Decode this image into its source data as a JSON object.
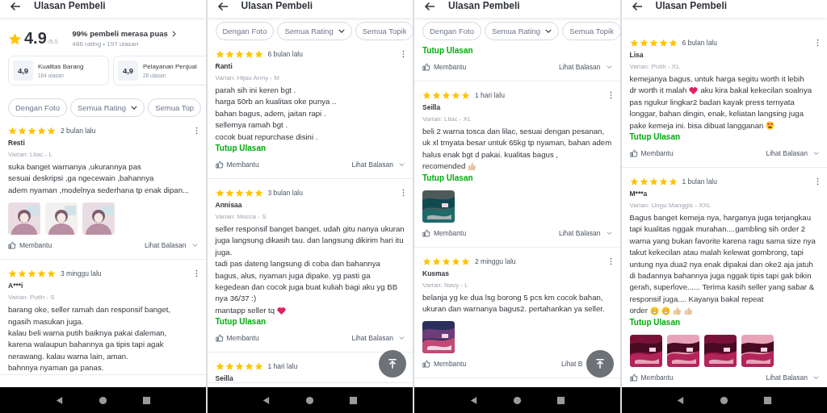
{
  "screens": [
    {
      "header": {
        "title": "Ulasan Pembeli"
      },
      "summary": {
        "score": "4.9",
        "scale": "/5.0",
        "headline": "99% pembeli merasa puas",
        "counts": "486 rating • 197 ulasan",
        "aspects": [
          {
            "score": "4,9",
            "label": "Kualitas Barang",
            "count": "164 ulasan"
          },
          {
            "score": "4,9",
            "label": "Pelayanan Penjual",
            "count": "28 ulasan"
          }
        ]
      },
      "filters": [
        {
          "label": "Dengan Foto",
          "dropdown": false
        },
        {
          "label": "Semua Rating",
          "dropdown": true
        },
        {
          "label": "Semua Top",
          "dropdown": false
        }
      ],
      "reviews": [
        {
          "stars": 5,
          "time": "2 bulan lalu",
          "menu": true,
          "name": "Resti",
          "variant": "Varian: Lilac - L",
          "body": [
            {
              "parts": [
                {
                  "kind": "text",
                  "text": "suka banget warnanya ,ukurannya pas\nsesuai deskripsi ,ga ngecewain ,bahannya\nadem nyaman ,modelnya sederhana tp enak dipan..."
                }
              ]
            }
          ],
          "photos": [
            {
              "kind": "picture"
            },
            {
              "kind": "picture"
            },
            {
              "kind": "picture"
            }
          ],
          "helpful": "Membantu",
          "replies": "Lihat Balasan",
          "chevron": true
        },
        {
          "stars": 5,
          "time": "3 minggu lalu",
          "menu": true,
          "name": "A***i",
          "variant": "Varian: Putih - S",
          "body": [
            {
              "parts": [
                {
                  "kind": "text",
                  "text": "barang oke, seller ramah dan responsif banget,\nngasih masukan juga.\nkalau beli warna putih baiknya pakai daleman,\nkarena walaupun bahannya ga tipis tapi agak\nnerawang. kalau warna lain, aman.\nbahnnya nyaman ga panas."
                }
              ]
            }
          ]
        }
      ],
      "scroll_top": false
    },
    {
      "header": {
        "title": "Ulasan Pembeli"
      },
      "filters": [
        {
          "label": "Dengan Foto",
          "dropdown": false
        },
        {
          "label": "Semua Rating",
          "dropdown": true
        },
        {
          "label": "Semua Topik",
          "dropdown": false
        }
      ],
      "reviews": [
        {
          "stars": 5,
          "time": "6 bulan lalu",
          "menu": true,
          "name": "Ranti",
          "variant": "Varian: Hijau Army - M",
          "body": [
            {
              "parts": [
                {
                  "kind": "text",
                  "text": "parah sih ini keren bgt .\nharga 50rb an kualitas oke punya ..\nbahan bagus, adem, jaitan rapi .\nsellernya ramah bgt .\ncocok buat repurchase disini ."
                }
              ]
            }
          ],
          "collapse": "Tutup Ulasan",
          "helpful": "Membantu",
          "replies": "Lihat Balasan",
          "chevron": true
        },
        {
          "stars": 5,
          "time": "3 bulan lalu",
          "menu": true,
          "name": "Annisaa",
          "variant": "Varian: Mocca - S",
          "body": [
            {
              "parts": [
                {
                  "kind": "text",
                  "text": "seller responsif banget banget. udah gitu nanya ukuran juga langsung dikasih tau. dan langsung dikirim hari itu juga.\ntadi pas dateng langsung di coba dan bahannya bagus, alus, nyaman juga dipake. yg pasti ga kegedean dan cocok juga buat kuliah bagi aku yg BB nya 36/37 :)"
                }
              ]
            },
            {
              "parts": [
                {
                  "kind": "text",
                  "text": "mantapp seller tq"
                },
                {
                  "kind": "heart"
                }
              ]
            }
          ],
          "collapse": "Tutup Ulasan",
          "helpful": "Membantu",
          "replies": "Lihat Balasan",
          "chevron": true
        },
        {
          "stars": 5,
          "time": "1 hari lalu",
          "name": "Seilla"
        }
      ],
      "scroll_top": true
    },
    {
      "header": {
        "title": "Ulasan Pembeli"
      },
      "filters": [
        {
          "label": "Dengan Foto",
          "dropdown": false
        },
        {
          "label": "Semua Rating",
          "dropdown": true
        },
        {
          "label": "Semua Topik",
          "dropdown": false
        }
      ],
      "reviews": [
        {
          "collapse": "Tutup Ulasan",
          "helpful": "Membantu",
          "replies": "Lihat Balasan",
          "chevron": true
        },
        {
          "stars": 5,
          "time": "1 hari lalu",
          "menu": true,
          "name": "Seilla",
          "variant": "Varian: Lilac - XL",
          "body": [
            {
              "parts": [
                {
                  "kind": "text",
                  "text": "beli 2 warna tosca dan lilac, sesuai dengan pesanan, uk xl trnyata besar untuk 65kg tp nyaman, bahan adem halus enak bgt d pakai. kualitas bagus ,"
                }
              ]
            },
            {
              "parts": [
                {
                  "kind": "text",
                  "text": "recomended"
                },
                {
                  "kind": "thumb"
                }
              ]
            }
          ],
          "collapse": "Tutup Ulasan",
          "photos": [
            {
              "kind": "picture"
            }
          ],
          "helpful": "Membantu",
          "replies": "Lihat Balasan",
          "chevron": true
        },
        {
          "stars": 5,
          "time": "2 minggu lalu",
          "menu": true,
          "name": "Kusmas",
          "variant": "Varian: Navy - L",
          "body": [
            {
              "parts": [
                {
                  "kind": "text",
                  "text": "belanja yg ke dua lsg borong 5 pcs km cocok bahan, ukuran dan warnanya bagus2. pertahankan ya seller."
                }
              ]
            }
          ],
          "photos": [
            {
              "kind": "picture"
            }
          ],
          "helpful": "Membantu",
          "replies": "Lihat B",
          "chevron": false
        }
      ],
      "scroll_top": true
    },
    {
      "header": {
        "title": "Ulasan Pembeli"
      },
      "reviews": [
        {
          "stars": 5,
          "time": "6 bulan lalu",
          "menu": true,
          "name": "Lisa",
          "variant": "Varian: Putih - XL",
          "body": [
            {
              "parts": [
                {
                  "kind": "text",
                  "text": "kemejanya bagus, untuk harga segitu worth it lebih"
                }
              ]
            },
            {
              "parts": [
                {
                  "kind": "text",
                  "text": "dr worth it malah"
                },
                {
                  "kind": "heart"
                },
                {
                  "kind": "text",
                  "text": "aku kira bakal kekecilan soalnya"
                }
              ]
            },
            {
              "parts": [
                {
                  "kind": "text",
                  "text": "pas ngukur lingkar2 badan kayak press ternyata longgar, bahan dingin, enak, keliatan langsing juga"
                }
              ]
            },
            {
              "parts": [
                {
                  "kind": "text",
                  "text": "pake kemeja ini. bisa dibuat langganan"
                },
                {
                  "kind": "heart-eyes"
                }
              ]
            }
          ],
          "collapse": "Tutup Ulasan",
          "helpful": "Membantu",
          "replies": "Lihat Balasan",
          "chevron": true
        },
        {
          "stars": 5,
          "time": "1 bulan lalu",
          "menu": true,
          "name": "M***a",
          "variant": "Varian: Ungu Manggis - XXL",
          "body": [
            {
              "parts": [
                {
                  "kind": "text",
                  "text": "Bagus banget kemeja nya, harganya juga terjangkau tapi kualitas nggak murahan....gambling sih order 2 warna yang bukan favorite karena ragu sama size nya takut kekecilan atau malah kelewat gombrong, tapi untung nya dua2 nya enak dipakai dan oke2 aja jatuh di badannya bahannya juga nggak tipis tapi gak bikin gerah, superlove...... Terima kasih seller yang sabar & responsif juga.... Kayanya bakal repeat"
                }
              ]
            },
            {
              "parts": [
                {
                  "kind": "text",
                  "text": "order"
                },
                {
                  "kind": "grin"
                },
                {
                  "kind": "grin"
                },
                {
                  "kind": "thumb"
                },
                {
                  "kind": "thumb"
                }
              ]
            }
          ],
          "collapse": "Tutup Ulasan",
          "photos": [
            {
              "kind": "picture"
            },
            {
              "kind": "picture"
            },
            {
              "kind": "picture"
            },
            {
              "kind": "picture"
            }
          ],
          "helpful": "Membantu",
          "replies": "Lihat Balasan",
          "chevron": true
        }
      ],
      "scroll_top": false
    }
  ]
}
